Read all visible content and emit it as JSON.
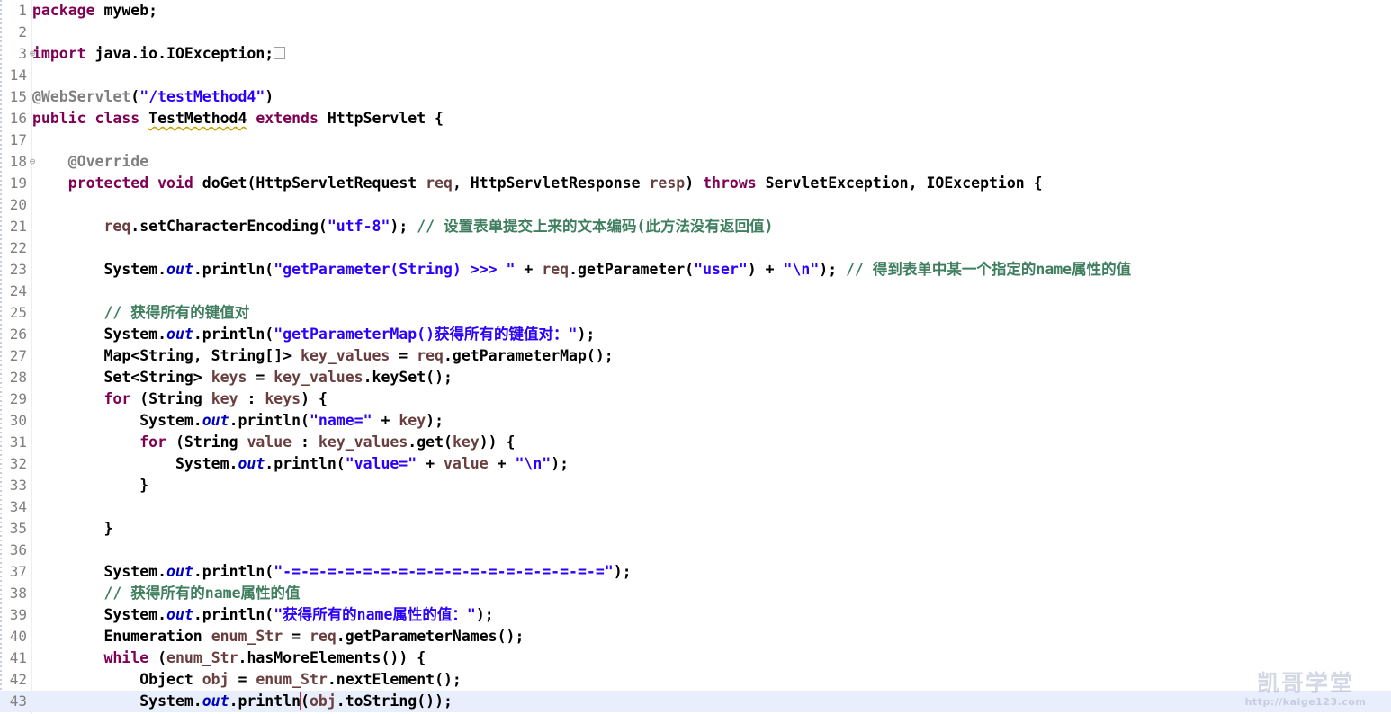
{
  "editor": {
    "language": "java",
    "theme_colors": {
      "background": "#ffffff",
      "current_line": "#e8eefb",
      "keyword": "#7f0055",
      "string": "#2a00ff",
      "comment": "#3f7f5f",
      "annotation": "#808080",
      "static_field": "#0000c0",
      "parameter": "#6a3e3e",
      "line_number": "#808080",
      "bracket_match_outline": "#c03030"
    },
    "current_line_number": 43,
    "cursor_line": 43,
    "fold_markers": {
      "3": "collapsed",
      "18": "expanded"
    },
    "collapsed_import_placeholder": "…",
    "lines": [
      {
        "n": "1",
        "fold": "",
        "tokens": [
          {
            "t": "kw",
            "v": "package"
          },
          {
            "t": "pln",
            "v": " myweb;"
          }
        ]
      },
      {
        "n": "2",
        "fold": "",
        "tokens": []
      },
      {
        "n": "3",
        "fold": "⊕",
        "tokens": [
          {
            "t": "kw",
            "v": "import"
          },
          {
            "t": "pln",
            "v": " java.io.IOException;"
          },
          {
            "t": "foldbox",
            "v": ""
          }
        ]
      },
      {
        "n": "14",
        "fold": "",
        "tokens": []
      },
      {
        "n": "15",
        "fold": "",
        "tokens": [
          {
            "t": "ann",
            "v": "@WebServlet"
          },
          {
            "t": "pln",
            "v": "("
          },
          {
            "t": "str",
            "v": "\"/testMethod4\""
          },
          {
            "t": "pln",
            "v": ")"
          }
        ]
      },
      {
        "n": "16",
        "fold": "",
        "tokens": [
          {
            "t": "kw",
            "v": "public"
          },
          {
            "t": "pln",
            "v": " "
          },
          {
            "t": "kw",
            "v": "class"
          },
          {
            "t": "pln",
            "v": " "
          },
          {
            "t": "warn",
            "v": "TestMethod4"
          },
          {
            "t": "pln",
            "v": " "
          },
          {
            "t": "kw",
            "v": "extends"
          },
          {
            "t": "pln",
            "v": " HttpServlet {"
          }
        ]
      },
      {
        "n": "17",
        "fold": "",
        "tokens": []
      },
      {
        "n": "18",
        "fold": "⊖",
        "tokens": [
          {
            "t": "ann",
            "v": "    @Override"
          }
        ]
      },
      {
        "n": "19",
        "fold": "",
        "tokens": [
          {
            "t": "pln",
            "v": "    "
          },
          {
            "t": "kw",
            "v": "protected"
          },
          {
            "t": "pln",
            "v": " "
          },
          {
            "t": "kw",
            "v": "void"
          },
          {
            "t": "pln",
            "v": " doGet(HttpServletRequest "
          },
          {
            "t": "par",
            "v": "req"
          },
          {
            "t": "pln",
            "v": ", HttpServletResponse "
          },
          {
            "t": "par",
            "v": "resp"
          },
          {
            "t": "pln",
            "v": ") "
          },
          {
            "t": "kw",
            "v": "throws"
          },
          {
            "t": "pln",
            "v": " ServletException, IOException {"
          }
        ]
      },
      {
        "n": "20",
        "fold": "",
        "tokens": []
      },
      {
        "n": "21",
        "fold": "",
        "tokens": [
          {
            "t": "pln",
            "v": "        "
          },
          {
            "t": "par",
            "v": "req"
          },
          {
            "t": "pln",
            "v": ".setCharacterEncoding("
          },
          {
            "t": "str",
            "v": "\"utf-8\""
          },
          {
            "t": "pln",
            "v": "); "
          },
          {
            "t": "cmt",
            "v": "// 设置表单提交上来的文本编码(此方法没有返回值)"
          }
        ]
      },
      {
        "n": "22",
        "fold": "",
        "tokens": []
      },
      {
        "n": "23",
        "fold": "",
        "tokens": [
          {
            "t": "pln",
            "v": "        System."
          },
          {
            "t": "fld",
            "v": "out"
          },
          {
            "t": "pln",
            "v": ".println("
          },
          {
            "t": "str",
            "v": "\"getParameter(String) >>> \""
          },
          {
            "t": "pln",
            "v": " + "
          },
          {
            "t": "par",
            "v": "req"
          },
          {
            "t": "pln",
            "v": ".getParameter("
          },
          {
            "t": "str",
            "v": "\"user\""
          },
          {
            "t": "pln",
            "v": ") + "
          },
          {
            "t": "str",
            "v": "\"\\n\""
          },
          {
            "t": "pln",
            "v": "); "
          },
          {
            "t": "cmt",
            "v": "// 得到表单中某一个指定的name属性的值"
          }
        ]
      },
      {
        "n": "24",
        "fold": "",
        "tokens": []
      },
      {
        "n": "25",
        "fold": "",
        "tokens": [
          {
            "t": "cmt",
            "v": "        // 获得所有的键值对"
          }
        ]
      },
      {
        "n": "26",
        "fold": "",
        "tokens": [
          {
            "t": "pln",
            "v": "        System."
          },
          {
            "t": "fld",
            "v": "out"
          },
          {
            "t": "pln",
            "v": ".println("
          },
          {
            "t": "str",
            "v": "\"getParameterMap()获得所有的键值对："
          },
          {
            "t": "str",
            "v": "\""
          },
          {
            "t": "pln",
            "v": ");"
          }
        ]
      },
      {
        "n": "27",
        "fold": "",
        "tokens": [
          {
            "t": "pln",
            "v": "        Map<String, String[]> "
          },
          {
            "t": "par",
            "v": "key_values"
          },
          {
            "t": "pln",
            "v": " = "
          },
          {
            "t": "par",
            "v": "req"
          },
          {
            "t": "pln",
            "v": ".getParameterMap();"
          }
        ]
      },
      {
        "n": "28",
        "fold": "",
        "tokens": [
          {
            "t": "pln",
            "v": "        Set<String> "
          },
          {
            "t": "par",
            "v": "keys"
          },
          {
            "t": "pln",
            "v": " = "
          },
          {
            "t": "par",
            "v": "key_values"
          },
          {
            "t": "pln",
            "v": ".keySet();"
          }
        ]
      },
      {
        "n": "29",
        "fold": "",
        "tokens": [
          {
            "t": "pln",
            "v": "        "
          },
          {
            "t": "kw",
            "v": "for"
          },
          {
            "t": "pln",
            "v": " (String "
          },
          {
            "t": "par",
            "v": "key"
          },
          {
            "t": "pln",
            "v": " : "
          },
          {
            "t": "par",
            "v": "keys"
          },
          {
            "t": "pln",
            "v": ") {"
          }
        ]
      },
      {
        "n": "30",
        "fold": "",
        "tokens": [
          {
            "t": "pln",
            "v": "            System."
          },
          {
            "t": "fld",
            "v": "out"
          },
          {
            "t": "pln",
            "v": ".println("
          },
          {
            "t": "str",
            "v": "\"name=\""
          },
          {
            "t": "pln",
            "v": " + "
          },
          {
            "t": "par",
            "v": "key"
          },
          {
            "t": "pln",
            "v": ");"
          }
        ]
      },
      {
        "n": "31",
        "fold": "",
        "tokens": [
          {
            "t": "pln",
            "v": "            "
          },
          {
            "t": "kw",
            "v": "for"
          },
          {
            "t": "pln",
            "v": " (String "
          },
          {
            "t": "par",
            "v": "value"
          },
          {
            "t": "pln",
            "v": " : "
          },
          {
            "t": "par",
            "v": "key_values"
          },
          {
            "t": "pln",
            "v": ".get("
          },
          {
            "t": "par",
            "v": "key"
          },
          {
            "t": "pln",
            "v": ")) {"
          }
        ]
      },
      {
        "n": "32",
        "fold": "",
        "tokens": [
          {
            "t": "pln",
            "v": "                System."
          },
          {
            "t": "fld",
            "v": "out"
          },
          {
            "t": "pln",
            "v": ".println("
          },
          {
            "t": "str",
            "v": "\"value=\""
          },
          {
            "t": "pln",
            "v": " + "
          },
          {
            "t": "par",
            "v": "value"
          },
          {
            "t": "pln",
            "v": " + "
          },
          {
            "t": "str",
            "v": "\"\\n\""
          },
          {
            "t": "pln",
            "v": ");"
          }
        ]
      },
      {
        "n": "33",
        "fold": "",
        "tokens": [
          {
            "t": "pln",
            "v": "            }"
          }
        ]
      },
      {
        "n": "34",
        "fold": "",
        "tokens": []
      },
      {
        "n": "35",
        "fold": "",
        "tokens": [
          {
            "t": "pln",
            "v": "        }"
          }
        ]
      },
      {
        "n": "36",
        "fold": "",
        "tokens": []
      },
      {
        "n": "37",
        "fold": "",
        "tokens": [
          {
            "t": "pln",
            "v": "        System."
          },
          {
            "t": "fld",
            "v": "out"
          },
          {
            "t": "pln",
            "v": ".println("
          },
          {
            "t": "str",
            "v": "\"-=-=-=-=-=-=-=-=-=-=-=-=-=-=-=-=-=-=\""
          },
          {
            "t": "pln",
            "v": ");"
          }
        ]
      },
      {
        "n": "38",
        "fold": "",
        "tokens": [
          {
            "t": "cmt",
            "v": "        // 获得所有的name属性的值"
          }
        ]
      },
      {
        "n": "39",
        "fold": "",
        "tokens": [
          {
            "t": "pln",
            "v": "        System."
          },
          {
            "t": "fld",
            "v": "out"
          },
          {
            "t": "pln",
            "v": ".println("
          },
          {
            "t": "str",
            "v": "\"获得所有的name属性的值：\""
          },
          {
            "t": "pln",
            "v": ");"
          }
        ]
      },
      {
        "n": "40",
        "fold": "",
        "tokens": [
          {
            "t": "pln",
            "v": "        Enumeration "
          },
          {
            "t": "par",
            "v": "enum_Str"
          },
          {
            "t": "pln",
            "v": " = "
          },
          {
            "t": "par",
            "v": "req"
          },
          {
            "t": "pln",
            "v": ".getParameterNames();"
          }
        ]
      },
      {
        "n": "41",
        "fold": "",
        "tokens": [
          {
            "t": "pln",
            "v": "        "
          },
          {
            "t": "kw",
            "v": "while"
          },
          {
            "t": "pln",
            "v": " ("
          },
          {
            "t": "par",
            "v": "enum_Str"
          },
          {
            "t": "pln",
            "v": ".hasMoreElements()) {"
          }
        ]
      },
      {
        "n": "42",
        "fold": "",
        "tokens": [
          {
            "t": "pln",
            "v": "            Object "
          },
          {
            "t": "par",
            "v": "obj"
          },
          {
            "t": "pln",
            "v": " = "
          },
          {
            "t": "par",
            "v": "enum_Str"
          },
          {
            "t": "pln",
            "v": ".nextElement();"
          }
        ]
      },
      {
        "n": "43",
        "fold": "",
        "current": true,
        "tokens": [
          {
            "t": "pln",
            "v": "            System."
          },
          {
            "t": "fld",
            "v": "out"
          },
          {
            "t": "pln",
            "v": ".println"
          },
          {
            "t": "bracket",
            "v": "("
          },
          {
            "t": "par",
            "v": "obj"
          },
          {
            "t": "pln",
            "v": ".toString());"
          }
        ]
      }
    ]
  },
  "watermark": {
    "brand": "凯哥学堂",
    "url": "http://kaige123.com"
  }
}
